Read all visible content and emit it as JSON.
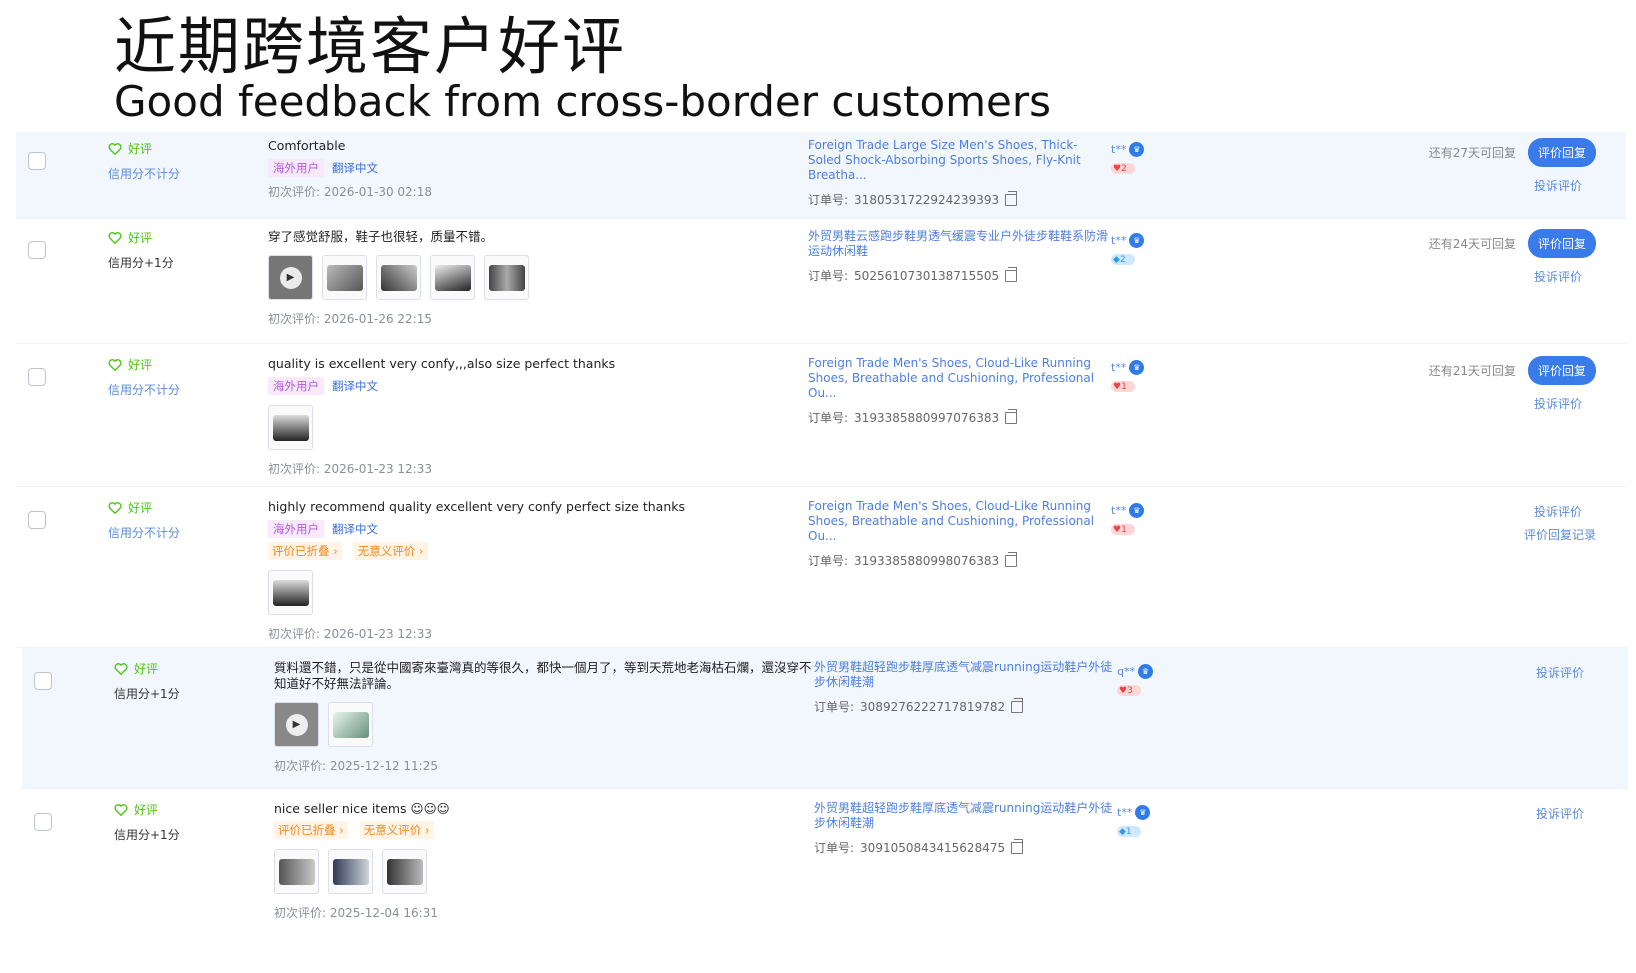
{
  "hero": {
    "title_cn": "近期跨境客户好评",
    "title_en": "Good feedback from cross-border customers"
  },
  "labels": {
    "good": "好评",
    "overseas": "海外用户",
    "translate": "翻译中文",
    "folded": "评价已折叠 ›",
    "meaningless": "无意义评价 ›",
    "reply": "评价回复",
    "complain": "投诉评价",
    "reply_record": "评价回复记录",
    "order_prefix": "订单号: ",
    "first_review_prefix": "初次评价: "
  },
  "reviews": [
    {
      "credit": "信用分不计分",
      "text": "Comfortable",
      "date": "2026-01-30 02:18",
      "product": "Foreign Trade Large Size Men's Shoes, Thick-Soled Shock-Absorbing Sports Shoes, Fly-Knit Breatha...",
      "order": "3180531722924239393",
      "buyer": "t**",
      "level": "2",
      "remain": "还有27天可回复"
    },
    {
      "credit": "信用分+1分",
      "text": "穿了感觉舒服，鞋子也很轻，质量不错。",
      "date": "2026-01-26 22:15",
      "product": "外贸男鞋云感跑步鞋男透气缓震专业户外徒步鞋鞋系防滑运动休闲鞋",
      "order": "5025610730138715505",
      "buyer": "t**",
      "level": "2",
      "remain": "还有24天可回复"
    },
    {
      "credit": "信用分不计分",
      "text": "quality is excellent very confy,,,also size perfect thanks",
      "date": "2026-01-23 12:33",
      "product": "Foreign Trade Men's Shoes, Cloud-Like Running Shoes, Breathable and Cushioning, Professional Ou...",
      "order": "3193385880997076383",
      "buyer": "t**",
      "level": "1",
      "remain": "还有21天可回复"
    },
    {
      "credit": "信用分不计分",
      "text": "highly recommend quality excellent very confy perfect size thanks",
      "date": "2026-01-23 12:33",
      "product": "Foreign Trade Men's Shoes, Cloud-Like Running Shoes, Breathable and Cushioning, Professional Ou...",
      "order": "3193385880998076383",
      "buyer": "t**",
      "level": "1"
    },
    {
      "credit": "信用分+1分",
      "text": "質料還不錯，只是從中國寄來臺灣真的等很久，都快一個月了，等到天荒地老海枯石爛，還沒穿不知道好不好無法評論。",
      "date": "2025-12-12 11:25",
      "product": "外贸男鞋超轻跑步鞋厚底透气减震running运动鞋户外徒步休闲鞋潮",
      "order": "3089276222717819782",
      "buyer": "q**",
      "level": "3"
    },
    {
      "credit": "信用分+1分",
      "text": "nice seller nice items ☺☺☺",
      "date": "2025-12-04 16:31",
      "product": "外贸男鞋超轻跑步鞋厚底透气减震running运动鞋户外徒步休闲鞋潮",
      "order": "3091050843415628475",
      "buyer": "t**",
      "level": "1"
    }
  ],
  "colors": {
    "accent": "#3a7bea",
    "good": "#52c41a",
    "link": "#5b8bd9"
  }
}
